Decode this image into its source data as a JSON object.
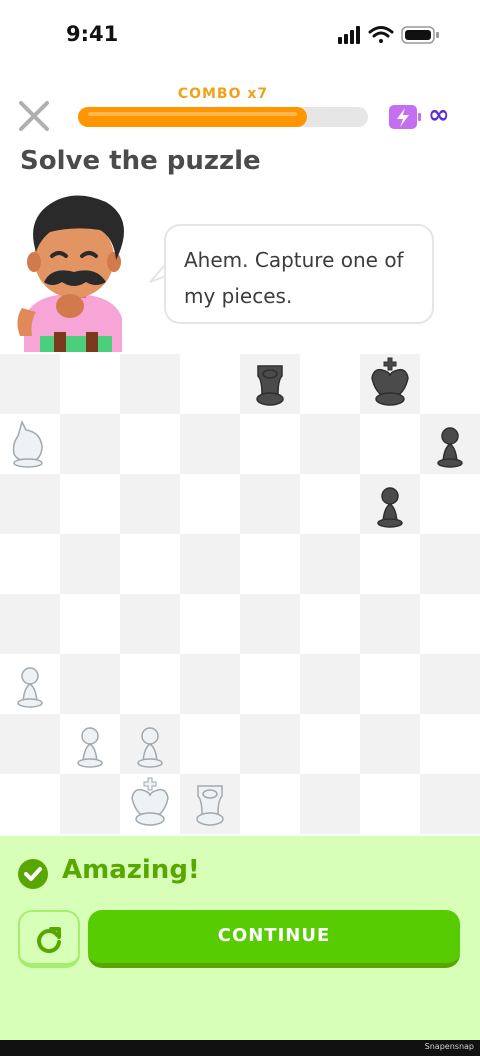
{
  "status_bar": {
    "time": "9:41"
  },
  "header": {
    "combo_label": "COMBO x7",
    "progress_fraction": 0.79,
    "energy_label": "∞"
  },
  "prompt": {
    "title": "Solve the puzzle",
    "speech": "Ahem. Capture one of my pieces."
  },
  "board": {
    "light_square": "#ffffff",
    "dark_square": "#f2f2f2",
    "pieces": [
      {
        "type": "rook",
        "color": "black",
        "square": "e8"
      },
      {
        "type": "king",
        "color": "black",
        "square": "g8"
      },
      {
        "type": "knight",
        "color": "white",
        "square": "a7"
      },
      {
        "type": "pawn",
        "color": "black",
        "square": "h7"
      },
      {
        "type": "pawn",
        "color": "black",
        "square": "g6"
      },
      {
        "type": "pawn",
        "color": "white",
        "square": "a3"
      },
      {
        "type": "pawn",
        "color": "white",
        "square": "b2"
      },
      {
        "type": "pawn",
        "color": "white",
        "square": "c2"
      },
      {
        "type": "king",
        "color": "white",
        "square": "c1"
      },
      {
        "type": "rook",
        "color": "white",
        "square": "d1"
      }
    ]
  },
  "feedback": {
    "message": "Amazing!",
    "continue_label": "CONTINUE",
    "accent_color": "#58cc02",
    "background_color": "#d7ffb8"
  },
  "watermark": "Snapensnap"
}
